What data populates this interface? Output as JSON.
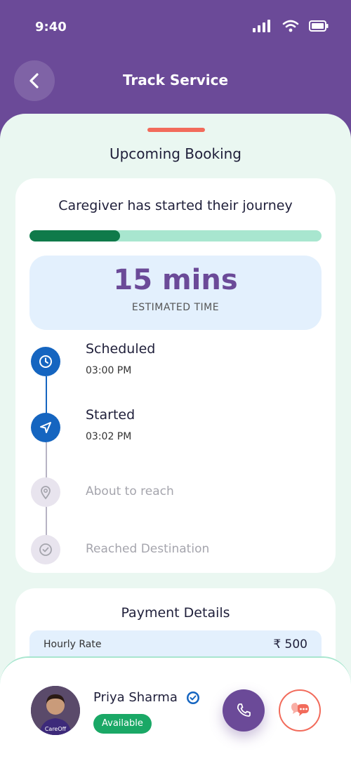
{
  "status_bar": {
    "time": "9:40"
  },
  "header": {
    "title": "Track Service"
  },
  "sheet": {
    "title": "Upcoming Booking"
  },
  "tracking": {
    "message": "Caregiver has started their journey",
    "progress_fraction": 0.31,
    "eta_value": "15 mins",
    "eta_label": "ESTIMATED TIME"
  },
  "timeline": {
    "steps": [
      {
        "label": "Scheduled",
        "time": "03:00 PM",
        "icon": "clock-icon",
        "state": "done"
      },
      {
        "label": "Started",
        "time": "03:02 PM",
        "icon": "navigation-icon",
        "state": "done"
      },
      {
        "label": "About to reach",
        "time": "",
        "icon": "location-pin-icon",
        "state": "pending"
      },
      {
        "label": "Reached Destination",
        "time": "",
        "icon": "check-circle-icon",
        "state": "pending"
      }
    ]
  },
  "payment": {
    "title": "Payment Details",
    "rows": [
      {
        "label": "Hourly Rate",
        "value": "₹ 500"
      }
    ]
  },
  "caregiver": {
    "name": "Priya Sharma",
    "status": "Available",
    "avatar_label": "CareOff"
  },
  "colors": {
    "brand_purple": "#6b4a98",
    "accent_coral": "#f26b5b",
    "progress_green": "#0f7a4a",
    "timeline_blue": "#1565c0",
    "available_green": "#1aa866"
  }
}
